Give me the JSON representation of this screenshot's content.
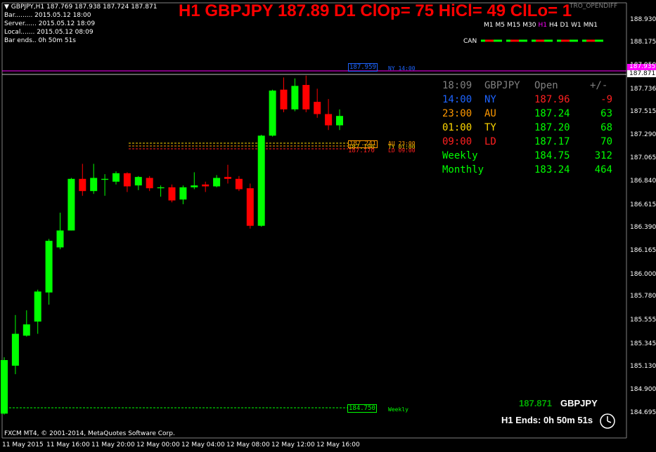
{
  "header": {
    "symbol_line": "GBPJPY,H1  187.769 187.938 187.724 187.871",
    "info_lines": [
      "Bar......... 2015.05.12 18:00",
      "Server...... 2015.05.12 18:09",
      "Local....... 2015.05.12 08:09",
      "Bar ends.. 0h 50m 51s"
    ],
    "big_title": "H1 GBPJPY 187.89 D1 ClOp= 75 HiCl= 49 ClLo= 1",
    "indicator_name": "TRO_OPENDIFF"
  },
  "timeframes": [
    "M1",
    "M5",
    "M15",
    "M30",
    "H1",
    "H4",
    "D1",
    "W1",
    "MN1"
  ],
  "active_timeframe": "H1",
  "can_label": "CAN",
  "session_table": {
    "header": [
      "18:09",
      "GBPJPY",
      "Open",
      "+/-"
    ],
    "rows": [
      {
        "time": "14:00",
        "name": "NY",
        "open": "187.96",
        "diff": "-9",
        "color": "#1e64ff",
        "open_color": "#ff2020",
        "diff_color": "#ff2020"
      },
      {
        "time": "23:00",
        "name": "AU",
        "open": "187.24",
        "diff": "63",
        "color": "#ff9900",
        "open_color": "#00ff00",
        "diff_color": "#00ff00"
      },
      {
        "time": "01:00",
        "name": "TY",
        "open": "187.20",
        "diff": "68",
        "color": "#ffd700",
        "open_color": "#00ff00",
        "diff_color": "#00ff00"
      },
      {
        "time": "09:00",
        "name": "LD",
        "open": "187.17",
        "diff": "70",
        "color": "#ff2020",
        "open_color": "#00ff00",
        "diff_color": "#00ff00"
      },
      {
        "time": "Weekly",
        "name": "",
        "open": "184.75",
        "diff": "312",
        "color": "#00ff00",
        "open_color": "#00ff00",
        "diff_color": "#00ff00"
      },
      {
        "time": "Monthly",
        "name": "",
        "open": "183.24",
        "diff": "464",
        "color": "#00ff00",
        "open_color": "#00ff00",
        "diff_color": "#00ff00"
      }
    ]
  },
  "price_axis": [
    "188.930",
    "188.175",
    "187.950",
    "187.736",
    "187.515",
    "187.290",
    "187.065",
    "186.840",
    "186.615",
    "186.390",
    "186.165",
    "186.000",
    "185.780",
    "185.555",
    "185.345",
    "185.130",
    "184.900",
    "184.695"
  ],
  "current_price": "187.871",
  "current_price_extra": "187.935",
  "level_boxes": [
    {
      "price": "187.959",
      "label": "NY 14:00",
      "color": "#1e64ff"
    },
    {
      "price": "187.241",
      "label": "AU 23:00",
      "color": "#ff9900"
    },
    {
      "price": "187.196",
      "label": "TY 01:00",
      "color": "#ffd700"
    },
    {
      "price": "187.170",
      "label": "LD 09:00",
      "color": "#ff2020"
    },
    {
      "price": "184.750",
      "label": "Weekly",
      "color": "#00ff00"
    }
  ],
  "time_axis": [
    "11 May 2015",
    "11 May 16:00",
    "11 May 20:00",
    "12 May 00:00",
    "12 May 04:00",
    "12 May 08:00",
    "12 May 12:00",
    "12 May 16:00"
  ],
  "footer": {
    "copyright": "FXCM MT4, © 2001-2014, MetaQuotes Software Corp.",
    "bottom_price": "187.871",
    "bottom_symbol": "GBPJPY",
    "bar_ends": "H1 Ends: 0h 50m 51s"
  },
  "colors": {
    "bull": "#00ff00",
    "bear": "#ff0000",
    "grid": "#808080"
  },
  "candles": [
    {
      "o": 184.7,
      "h": 185.3,
      "l": 184.69,
      "c": 185.27
    },
    {
      "o": 185.21,
      "h": 185.75,
      "l": 185.12,
      "c": 185.55
    },
    {
      "o": 185.53,
      "h": 185.8,
      "l": 185.52,
      "c": 185.65
    },
    {
      "o": 185.68,
      "h": 186.02,
      "l": 185.55,
      "c": 186.0
    },
    {
      "o": 185.99,
      "h": 186.56,
      "l": 185.86,
      "c": 186.54
    },
    {
      "o": 186.47,
      "h": 186.84,
      "l": 186.45,
      "c": 186.65
    },
    {
      "o": 186.65,
      "h": 187.21,
      "l": 186.65,
      "c": 187.2
    },
    {
      "o": 187.2,
      "h": 187.36,
      "l": 187.02,
      "c": 187.07
    },
    {
      "o": 187.07,
      "h": 187.36,
      "l": 187.04,
      "c": 187.21
    },
    {
      "o": 187.19,
      "h": 187.25,
      "l": 187.02,
      "c": 187.2
    },
    {
      "o": 187.17,
      "h": 187.28,
      "l": 187.14,
      "c": 187.26
    },
    {
      "o": 187.26,
      "h": 187.27,
      "l": 187.06,
      "c": 187.12
    },
    {
      "o": 187.13,
      "h": 187.23,
      "l": 187.08,
      "c": 187.22
    },
    {
      "o": 187.21,
      "h": 187.23,
      "l": 187.07,
      "c": 187.1
    },
    {
      "o": 187.1,
      "h": 187.13,
      "l": 187.01,
      "c": 187.11
    },
    {
      "o": 187.11,
      "h": 187.14,
      "l": 186.95,
      "c": 186.97
    },
    {
      "o": 186.98,
      "h": 187.13,
      "l": 186.93,
      "c": 187.11
    },
    {
      "o": 187.11,
      "h": 187.27,
      "l": 187.09,
      "c": 187.13
    },
    {
      "o": 187.14,
      "h": 187.17,
      "l": 187.06,
      "c": 187.12
    },
    {
      "o": 187.12,
      "h": 187.24,
      "l": 187.11,
      "c": 187.21
    },
    {
      "o": 187.22,
      "h": 187.35,
      "l": 187.15,
      "c": 187.2
    },
    {
      "o": 187.2,
      "h": 187.23,
      "l": 187.07,
      "c": 187.09
    },
    {
      "o": 187.1,
      "h": 187.15,
      "l": 186.67,
      "c": 186.7
    },
    {
      "o": 186.7,
      "h": 187.67,
      "l": 186.69,
      "c": 187.66
    },
    {
      "o": 187.66,
      "h": 188.15,
      "l": 187.65,
      "c": 188.14
    },
    {
      "o": 188.15,
      "h": 188.28,
      "l": 187.91,
      "c": 187.94
    },
    {
      "o": 187.94,
      "h": 188.27,
      "l": 187.92,
      "c": 188.19
    },
    {
      "o": 188.2,
      "h": 188.3,
      "l": 187.91,
      "c": 187.94
    },
    {
      "o": 188.02,
      "h": 188.16,
      "l": 187.85,
      "c": 187.89
    },
    {
      "o": 187.89,
      "h": 188.05,
      "l": 187.72,
      "c": 187.77
    },
    {
      "o": 187.77,
      "h": 187.94,
      "l": 187.72,
      "c": 187.87
    }
  ]
}
